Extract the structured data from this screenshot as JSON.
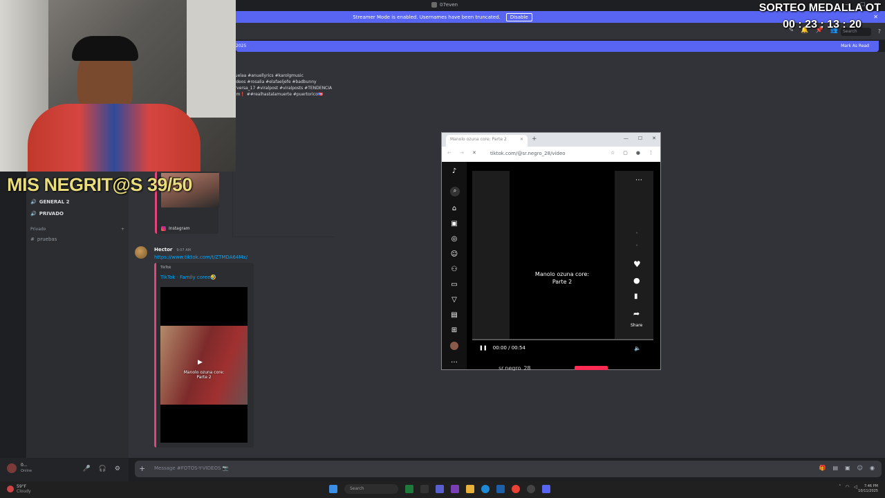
{
  "window": {
    "title": "07even",
    "controls": [
      "—",
      "☐",
      "✕"
    ]
  },
  "banner": {
    "text": "Streamer Mode is enabled. Usernames have been truncated.",
    "button": "Disable"
  },
  "toolbar": {
    "search_placeholder": "Search"
  },
  "new_messages": {
    "date_fragment": "2025",
    "mark_read": "Mark As Read"
  },
  "overlay": {
    "giveaway_title": "SORTEO MEDALLA OT",
    "timer": "00 : 23 : 13 : 20",
    "counter": "MIS NEGRIT@S 39/50"
  },
  "sidebar": {
    "channels": [
      {
        "label": "GENERAL 2"
      },
      {
        "label": "PRIVADO"
      }
    ],
    "category": "Privado",
    "text_channel": "pruebas"
  },
  "user_panel": {
    "name": "0...",
    "status": "Online"
  },
  "chat": {
    "hashtags": [
      "nuelaa #anuellyrics #karolgmusic",
      "videos #rosalia #elafaeljefe #badbunny",
      "erversa_17 #viralpost #viralposts #TENDENCIA",
      "him❗ ##realhastalamuerte #puertorico🇵🇷"
    ],
    "instagram_label": "Instagram",
    "message": {
      "author": "Hector",
      "time": "9:07 AM",
      "link": "https://www.tiktok.com/t/ZTMDA64Mx/",
      "embed_provider": "TikTok",
      "embed_title": "TikTok · Family coree🤣",
      "video_caption": "Manolo ozuna core:\nParte 2"
    },
    "composer_placeholder": "Message #FOTOS-Y-VIDEOS 📷"
  },
  "popup": {
    "tab_title": "Manolo ozuna core: Parte 2",
    "url": "tiktok.com/@sr.negro_28/video",
    "video_caption_line1": "Manolo ozuna core:",
    "video_caption_line2": "Parte 2",
    "time": "00:00 / 00:54",
    "share": "Share",
    "username": "sr.negro_28"
  },
  "taskbar": {
    "weather_temp": "59°F",
    "weather_desc": "Cloudy",
    "search": "Search",
    "time": "7:46 PM",
    "date": "10/11/2025"
  }
}
